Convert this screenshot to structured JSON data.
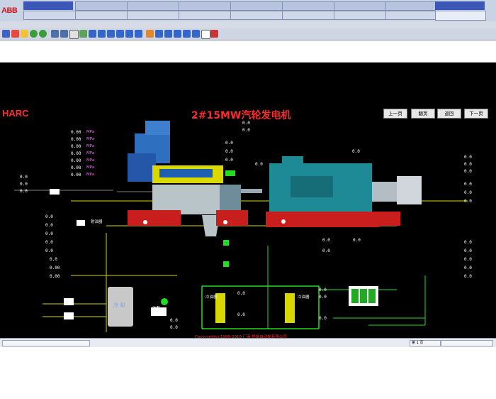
{
  "header": {
    "brand_logo": "ABB",
    "left_tag": "",
    "right_tag_top": "",
    "right_tag_bottom": "",
    "menu_text": ""
  },
  "screen": {
    "harc": "HARC",
    "harc_sub": "",
    "title": "2#15MW汽轮发电机",
    "nav": [
      "上一页",
      "翻页",
      "返回",
      "下一页"
    ],
    "copyright": "Copyright(c) 1999-2010 厂商 热能自动化有限公司"
  },
  "readings_left_top": [
    {
      "value": "0.00",
      "unit": "MPa"
    },
    {
      "value": "0.00",
      "unit": "MPa"
    },
    {
      "value": "0.00",
      "unit": "MPa"
    },
    {
      "value": "0.00",
      "unit": "MPa"
    },
    {
      "value": "0.00",
      "unit": "MPa"
    },
    {
      "value": "0.00",
      "unit": "MPa"
    },
    {
      "value": "0.00",
      "unit": "MPa"
    }
  ],
  "readings_left_side": [
    "0.0",
    "0.0",
    "0.0"
  ],
  "readings_left_mid": [
    "0.0",
    "0.0",
    "0.0",
    "0.0",
    "0.0",
    "0.0",
    "0.00",
    "0.00"
  ],
  "readings_center_top": [
    "0.0",
    "0.0",
    "0.0",
    "0.0",
    "0.0",
    "0.0",
    "0.0"
  ],
  "readings_right": [
    "0.0",
    "0.0",
    "0.0",
    "0.0",
    "0.0",
    "0.0"
  ],
  "readings_right_lower": [
    "0.0",
    "0.0",
    "0.0",
    "0.0",
    "0.0",
    "0.0",
    "0.0",
    "0.0"
  ],
  "readings_bottom": [
    "0.0",
    "0.0",
    "0.0",
    "0.0",
    "0.0",
    "0.0",
    "0.0"
  ],
  "labels": {
    "tank": "冷 却",
    "cooler_left": "冷油器",
    "cooler_right": "冷油器",
    "pump": "油泵",
    "front_pump": "射油器"
  },
  "colors": {
    "background": "#000000",
    "label": "#ffd700",
    "value": "#ffffff",
    "unit": "#ff66ff",
    "title": "#ff2a2a",
    "generator": "#1d8a96",
    "pipe_green": "#22dd22",
    "pipe_yellow": "#d8d800"
  },
  "status": {
    "left": "",
    "right": "第 1 页"
  }
}
